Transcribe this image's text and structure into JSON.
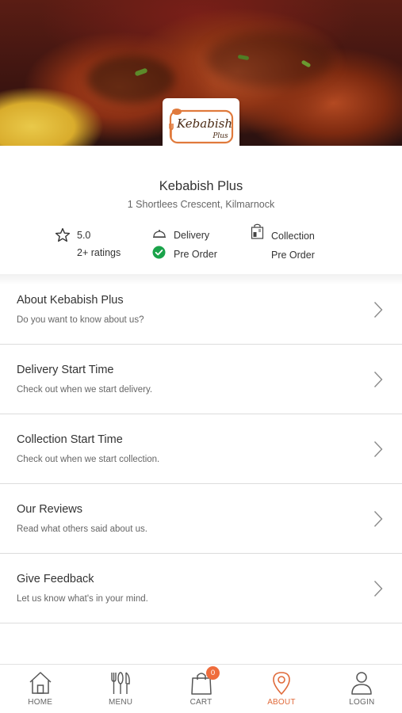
{
  "restaurant": {
    "name": "Kebabish Plus",
    "address": "1 Shortlees Crescent, Kilmarnock",
    "logo_text": "Kebabish",
    "logo_subtext": "Plus"
  },
  "stats": {
    "rating": "5.0",
    "ratings_count": "2+ ratings",
    "delivery_label": "Delivery",
    "delivery_preorder": "Pre Order",
    "collection_label": "Collection",
    "collection_preorder": "Pre Order"
  },
  "menu_items": [
    {
      "title": "About Kebabish Plus",
      "subtitle": "Do you want to know about us?"
    },
    {
      "title": "Delivery Start Time",
      "subtitle": "Check out when we start delivery."
    },
    {
      "title": "Collection Start Time",
      "subtitle": "Check out when we start collection."
    },
    {
      "title": "Our Reviews",
      "subtitle": "Read what others said about us."
    },
    {
      "title": "Give Feedback",
      "subtitle": "Let us know what's in your mind."
    }
  ],
  "nav": {
    "items": [
      {
        "label": "HOME",
        "icon": "home-icon"
      },
      {
        "label": "MENU",
        "icon": "cutlery-icon"
      },
      {
        "label": "CART",
        "icon": "shopping-bag-icon"
      },
      {
        "label": "ABOUT",
        "icon": "location-pin-icon"
      },
      {
        "label": "LOGIN",
        "icon": "user-icon"
      }
    ],
    "active": "ABOUT",
    "cart_count": "0"
  },
  "colors": {
    "accent": "#e06a3a",
    "badge": "#ef6c3c",
    "check": "#1aa34a"
  }
}
